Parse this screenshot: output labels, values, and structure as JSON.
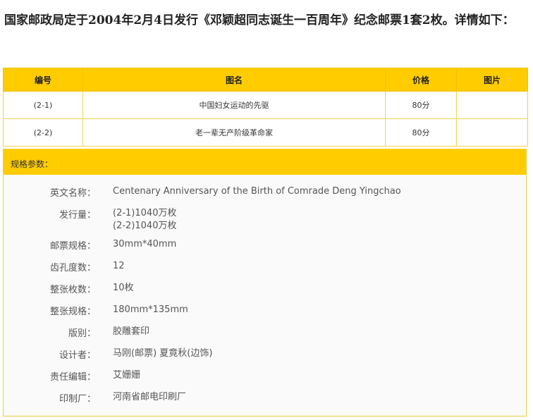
{
  "intro_text": "国家邮政局定于2004年2月4日发行《邓颖超同志诞生一百周年》纪念邮票1套2枚。详情如下：",
  "table": {
    "headers": {
      "num": "编号",
      "name": "图名",
      "price": "价格",
      "image": "图片"
    },
    "rows": [
      {
        "num": "(2-1)",
        "name": "中国妇女运动的先驱",
        "price": "80分",
        "image": ""
      },
      {
        "num": "(2-2)",
        "name": "老一辈无产阶级革命家",
        "price": "80分",
        "image": ""
      }
    ]
  },
  "specs": {
    "title": "规格参数：",
    "english_name": {
      "label": "英文名称：",
      "value": "Centenary Anniversary of the Birth of Comrade Deng Yingchao"
    },
    "circulation": {
      "label": "发行量：",
      "line1": "(2-1)1040万枚",
      "line2": "(2-2)1040万枚"
    },
    "stamp_size": {
      "label": "邮票规格：",
      "value": "30mm*40mm"
    },
    "perforation": {
      "label": "齿孔度数：",
      "value": "12"
    },
    "sheet_count": {
      "label": "整张枚数：",
      "value": "10枚"
    },
    "sheet_size": {
      "label": "整张规格：",
      "value": "180mm*135mm"
    },
    "printing_type": {
      "label": "版别：",
      "value": "胶雕套印"
    },
    "designer": {
      "label": "设计者：",
      "value": "马刚(邮票) 夏竟秋(边饰)"
    },
    "editor": {
      "label": "责任编辑：",
      "value": "艾姗姗"
    },
    "printer": {
      "label": "印制厂：",
      "value": "河南省邮电印刷厂"
    }
  },
  "colors": {
    "header_bg": "#ffcc00",
    "border": "#f3d24a"
  }
}
